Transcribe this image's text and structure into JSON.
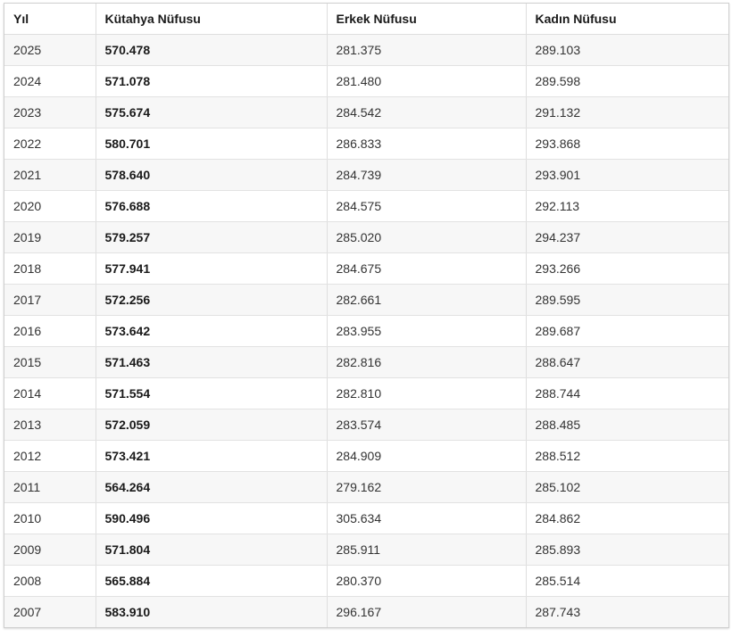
{
  "table": {
    "headers": [
      "Yıl",
      "Kütahya Nüfusu",
      "Erkek Nüfusu",
      "Kadın Nüfusu"
    ],
    "rows": [
      [
        "2025",
        "570.478",
        "281.375",
        "289.103"
      ],
      [
        "2024",
        "571.078",
        "281.480",
        "289.598"
      ],
      [
        "2023",
        "575.674",
        "284.542",
        "291.132"
      ],
      [
        "2022",
        "580.701",
        "286.833",
        "293.868"
      ],
      [
        "2021",
        "578.640",
        "284.739",
        "293.901"
      ],
      [
        "2020",
        "576.688",
        "284.575",
        "292.113"
      ],
      [
        "2019",
        "579.257",
        "285.020",
        "294.237"
      ],
      [
        "2018",
        "577.941",
        "284.675",
        "293.266"
      ],
      [
        "2017",
        "572.256",
        "282.661",
        "289.595"
      ],
      [
        "2016",
        "573.642",
        "283.955",
        "289.687"
      ],
      [
        "2015",
        "571.463",
        "282.816",
        "288.647"
      ],
      [
        "2014",
        "571.554",
        "282.810",
        "288.744"
      ],
      [
        "2013",
        "572.059",
        "283.574",
        "288.485"
      ],
      [
        "2012",
        "573.421",
        "284.909",
        "288.512"
      ],
      [
        "2011",
        "564.264",
        "279.162",
        "285.102"
      ],
      [
        "2010",
        "590.496",
        "305.634",
        "284.862"
      ],
      [
        "2009",
        "571.804",
        "285.911",
        "285.893"
      ],
      [
        "2008",
        "565.884",
        "280.370",
        "285.514"
      ],
      [
        "2007",
        "583.910",
        "296.167",
        "287.743"
      ]
    ]
  }
}
